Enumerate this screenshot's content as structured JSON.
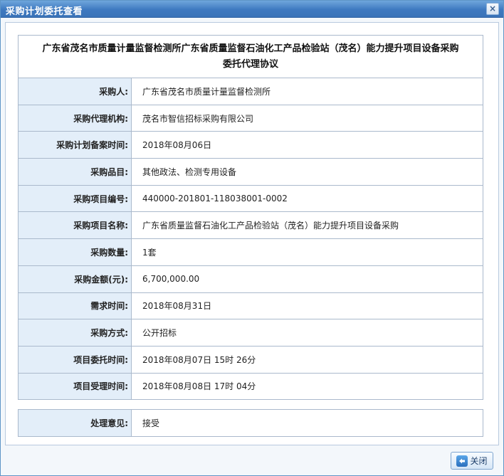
{
  "window": {
    "title": "采购计划委托查看",
    "close_glyph": "×"
  },
  "agreement": {
    "heading_line1": "广东省茂名市质量计量监督检测所广东省质量监督石油化工产品检验站（茂名）能力提升项目设备采购",
    "heading_line2": "委托代理协议"
  },
  "fields": [
    {
      "label": "采购人:",
      "value": "广东省茂名市质量计量监督检测所"
    },
    {
      "label": "采购代理机构:",
      "value": "茂名市智信招标采购有限公司"
    },
    {
      "label": "采购计划备案时间:",
      "value": "2018年08月06日"
    },
    {
      "label": "采购品目:",
      "value": "其他政法、检测专用设备"
    },
    {
      "label": "采购项目编号:",
      "value": "440000-201801-118038001-0002"
    },
    {
      "label": "采购项目名称:",
      "value": "广东省质量监督石油化工产品检验站（茂名）能力提升项目设备采购"
    },
    {
      "label": "采购数量:",
      "value": "1套"
    },
    {
      "label": "采购金额(元):",
      "value": "6,700,000.00"
    },
    {
      "label": "需求时间:",
      "value": "2018年08月31日"
    },
    {
      "label": "采购方式:",
      "value": "公开招标"
    },
    {
      "label": "项目委托时间:",
      "value": "2018年08月07日 15时 26分"
    },
    {
      "label": "项目受理时间:",
      "value": "2018年08月08日 17时 04分"
    }
  ],
  "opinion": {
    "label": "处理意见:",
    "value": "接受"
  },
  "footer": {
    "close_label": "关闭",
    "close_icon": "return-arrow-icon"
  },
  "colors": {
    "titlebar": "#3e79c0",
    "label_bg": "#e3eef9",
    "border": "#aab9cc"
  }
}
